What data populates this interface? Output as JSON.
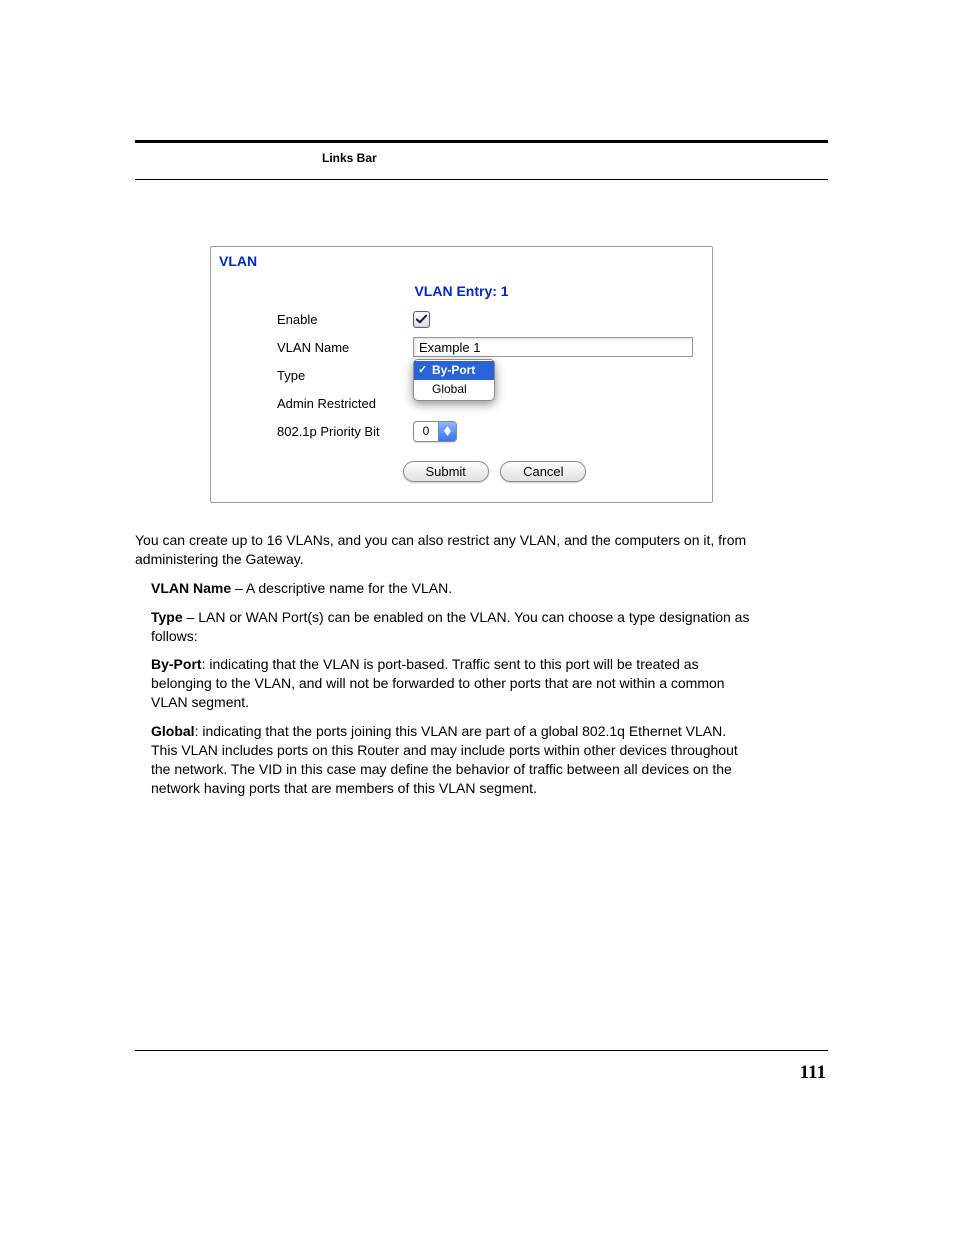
{
  "header": {
    "section": "Links Bar"
  },
  "panel": {
    "title": "VLAN",
    "entry_title": "VLAN Entry: 1",
    "labels": {
      "enable": "Enable",
      "vlan_name": "VLAN Name",
      "type": "Type",
      "admin_restricted": "Admin Restricted",
      "priority_bit": "802.1p Priority Bit"
    },
    "values": {
      "enable_checked": "true",
      "vlan_name": "Example 1",
      "priority_bit": "0"
    },
    "type_dropdown": {
      "option1": "By-Port",
      "option2": "Global"
    },
    "buttons": {
      "submit": "Submit",
      "cancel": "Cancel"
    }
  },
  "copy": {
    "p1": "You can create up to 16 VLANs, and you can also restrict any VLAN, and the computers on it, from administering the Gateway.",
    "vlan_name_b": "VLAN Name",
    "vlan_name_rest": " – A descriptive name for the VLAN.",
    "type_b": "Type",
    "type_rest": " – LAN or WAN Port(s) can be enabled on the VLAN. You can choose a type designation as follows:",
    "byport_b": "By-Port",
    "byport_rest": ": indicating that the VLAN is port-based. Traffic sent to this port will be treated as belonging to the VLAN, and will not be forwarded to other ports that are not within a common VLAN segment.",
    "global_b": "Global",
    "global_rest": ": indicating that the ports joining this VLAN are part of a global 802.1q Ethernet VLAN. This VLAN includes ports on this Router and may include ports within other devices throughout the network. The VID in this case may define the behavior of traffic between all devices on the network having ports that are members of this VLAN segment."
  },
  "page_number": "111"
}
